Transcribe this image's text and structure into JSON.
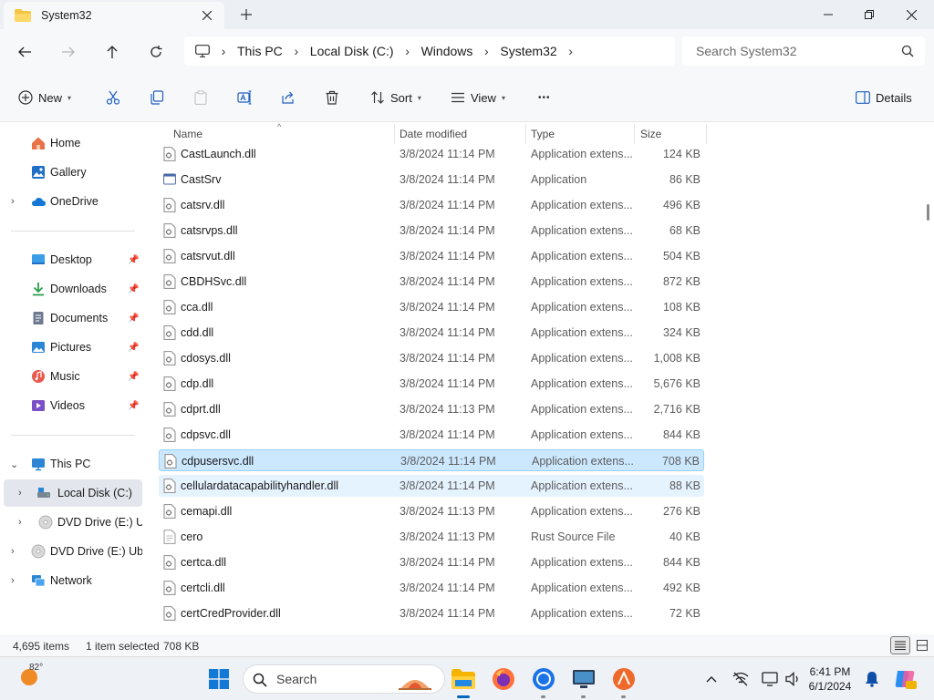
{
  "window": {
    "tab_title": "System32",
    "icons": {
      "tab": "folder-icon",
      "close": "close-icon",
      "new_tab": "plus-icon",
      "minimize": "minimize-icon",
      "maximize": "maximize-icon",
      "window_close": "close-icon"
    }
  },
  "address": {
    "crumbs": [
      "This PC",
      "Local Disk (C:)",
      "Windows",
      "System32"
    ],
    "search_placeholder": "Search System32"
  },
  "toolbar": {
    "new_label": "New",
    "sort_label": "Sort",
    "view_label": "View",
    "details_label": "Details",
    "more_label": "•••"
  },
  "sidebar": {
    "items": [
      {
        "label": "Home",
        "icon": "home-icon"
      },
      {
        "label": "Gallery",
        "icon": "gallery-icon"
      },
      {
        "label": "OneDrive",
        "icon": "cloud-icon"
      },
      {
        "label": "Desktop",
        "icon": "desktop-icon"
      },
      {
        "label": "Downloads",
        "icon": "download-icon"
      },
      {
        "label": "Documents",
        "icon": "documents-icon"
      },
      {
        "label": "Pictures",
        "icon": "pictures-icon"
      },
      {
        "label": "Music",
        "icon": "music-icon"
      },
      {
        "label": "Videos",
        "icon": "videos-icon"
      },
      {
        "label": "This PC",
        "icon": "pc-icon"
      },
      {
        "label": "Local Disk (C:)",
        "icon": "drive-icon"
      },
      {
        "label": "DVD Drive (E:) Ubu",
        "icon": "disc-icon"
      },
      {
        "label": "DVD Drive (E:) Ubun",
        "icon": "disc-icon"
      },
      {
        "label": "Network",
        "icon": "network-icon"
      }
    ]
  },
  "columns": {
    "name": "Name",
    "date": "Date modified",
    "type": "Type",
    "size": "Size"
  },
  "files": [
    {
      "name": "CastLaunch.dll",
      "date": "3/8/2024 11:14 PM",
      "type": "Application extens...",
      "size": "124 KB"
    },
    {
      "name": "CastSrv",
      "date": "3/8/2024 11:14 PM",
      "type": "Application",
      "size": "86 KB"
    },
    {
      "name": "catsrv.dll",
      "date": "3/8/2024 11:14 PM",
      "type": "Application extens...",
      "size": "496 KB"
    },
    {
      "name": "catsrvps.dll",
      "date": "3/8/2024 11:14 PM",
      "type": "Application extens...",
      "size": "68 KB"
    },
    {
      "name": "catsrvut.dll",
      "date": "3/8/2024 11:14 PM",
      "type": "Application extens...",
      "size": "504 KB"
    },
    {
      "name": "CBDHSvc.dll",
      "date": "3/8/2024 11:14 PM",
      "type": "Application extens...",
      "size": "872 KB"
    },
    {
      "name": "cca.dll",
      "date": "3/8/2024 11:14 PM",
      "type": "Application extens...",
      "size": "108 KB"
    },
    {
      "name": "cdd.dll",
      "date": "3/8/2024 11:14 PM",
      "type": "Application extens...",
      "size": "324 KB"
    },
    {
      "name": "cdosys.dll",
      "date": "3/8/2024 11:14 PM",
      "type": "Application extens...",
      "size": "1,008 KB"
    },
    {
      "name": "cdp.dll",
      "date": "3/8/2024 11:14 PM",
      "type": "Application extens...",
      "size": "5,676 KB"
    },
    {
      "name": "cdprt.dll",
      "date": "3/8/2024 11:13 PM",
      "type": "Application extens...",
      "size": "2,716 KB"
    },
    {
      "name": "cdpsvc.dll",
      "date": "3/8/2024 11:14 PM",
      "type": "Application extens...",
      "size": "844 KB"
    },
    {
      "name": "cdpusersvc.dll",
      "date": "3/8/2024 11:14 PM",
      "type": "Application extens...",
      "size": "708 KB"
    },
    {
      "name": "cellulardatacapabilityhandler.dll",
      "date": "3/8/2024 11:14 PM",
      "type": "Application extens...",
      "size": "88 KB"
    },
    {
      "name": "cemapi.dll",
      "date": "3/8/2024 11:13 PM",
      "type": "Application extens...",
      "size": "276 KB"
    },
    {
      "name": "cero",
      "date": "3/8/2024 11:13 PM",
      "type": "Rust Source File",
      "size": "40 KB"
    },
    {
      "name": "certca.dll",
      "date": "3/8/2024 11:14 PM",
      "type": "Application extens...",
      "size": "844 KB"
    },
    {
      "name": "certcli.dll",
      "date": "3/8/2024 11:14 PM",
      "type": "Application extens...",
      "size": "492 KB"
    },
    {
      "name": "certCredProvider.dll",
      "date": "3/8/2024 11:14 PM",
      "type": "Application extens...",
      "size": "72 KB"
    }
  ],
  "status": {
    "item_count": "4,695 items",
    "selection": "1 item selected",
    "selection_size": "708 KB"
  },
  "taskbar": {
    "temperature": "82°",
    "search_placeholder": "Search",
    "time": "6:41 PM",
    "date": "6/1/2024",
    "accent": "#0067c0"
  }
}
